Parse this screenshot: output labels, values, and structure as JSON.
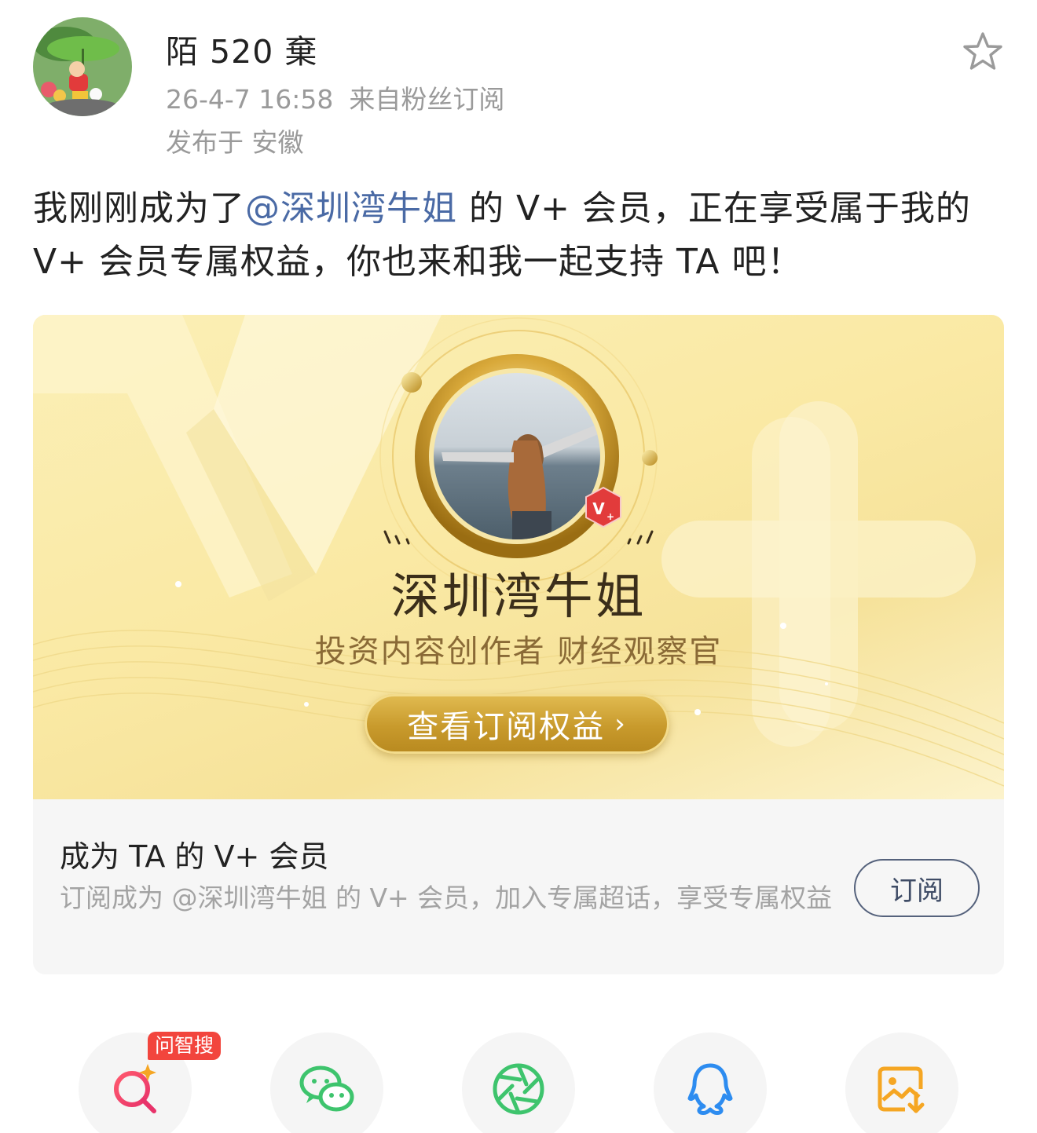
{
  "post": {
    "username": "陌 520 棄",
    "timestamp": "26-4-7 16:58",
    "source": "来自粉丝订阅",
    "location": "发布于 安徽",
    "text_before": "我刚刚成为了",
    "mention": "@深圳湾牛姐",
    "text_after": " 的 V+ 会员，正在享受属于我的 V+ 会员专属权益，你也来和我一起支持 TA 吧！"
  },
  "card": {
    "creator_name": "深圳湾牛姐",
    "creator_title": "投资内容创作者 财经观察官",
    "benefit_button": "查看订阅权益",
    "vip_badge": "V+",
    "subscribe_title": "成为 TA 的 V+ 会员",
    "subscribe_desc": "订阅成为 @深圳湾牛姐 的 V+ 会员，加入专属超话，享受专属权益",
    "subscribe_button": "订阅"
  },
  "share": {
    "badge": "问智搜",
    "items": [
      "search-ai-icon",
      "wechat-icon",
      "moments-icon",
      "qq-icon",
      "save-image-icon"
    ]
  },
  "colors": {
    "mention": "#4a6aa5",
    "gold": "#c89a2c",
    "badge_red": "#f2453d",
    "wechat_green": "#3ec46d",
    "qq_blue": "#2d8cf0",
    "save_orange": "#f5a623"
  }
}
